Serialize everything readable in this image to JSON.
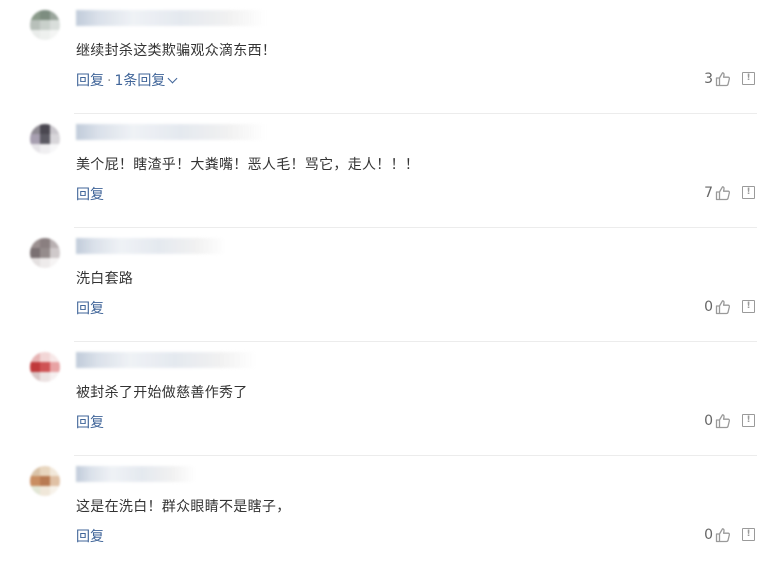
{
  "comments": [
    {
      "text": "继续封杀这类欺骗观众滴东西！",
      "reply_label": "回复",
      "reply_count_label": "1条回复",
      "likes": "3",
      "avatar_colors": [
        "#8a9a8a",
        "#7d8d80",
        "#9aa59c",
        "#b8c0ba",
        "#c9d0cb",
        "#d9dedb",
        "#e9ecea",
        "#eef0ee",
        "#f4f5f4"
      ]
    },
    {
      "text": "美个屁！瞎渣乎！大粪嘴！恶人毛！骂它，走人！！！",
      "reply_label": "回复",
      "likes": "7",
      "avatar_colors": [
        "#8e8a92",
        "#4a4750",
        "#c9c6cc",
        "#a79fb0",
        "#5c5a63",
        "#d8d6da",
        "#e6e4e8",
        "#f0eff1",
        "#f7f7f8"
      ]
    },
    {
      "text": "洗白套路",
      "reply_label": "回复",
      "likes": "0",
      "avatar_colors": [
        "#9a8f8f",
        "#8a7f80",
        "#b8b0b1",
        "#7a7072",
        "#958c8c",
        "#cfc9ca",
        "#e4e0e0",
        "#eeebeb",
        "#f6f4f4"
      ]
    },
    {
      "text": "被封杀了开始做慈善作秀了",
      "reply_label": "回复",
      "likes": "0",
      "avatar_colors": [
        "#e6b3b3",
        "#f2d6d6",
        "#f7e8e8",
        "#c0393b",
        "#cf5254",
        "#e8a3a4",
        "#d9c6c6",
        "#ece2e2",
        "#f6f0f0"
      ]
    },
    {
      "text": "这是在洗白！群众眼睛不是瞎子，",
      "reply_label": "回复",
      "likes": "0",
      "avatar_colors": [
        "#d9c3a8",
        "#e8d6bf",
        "#f2e8da",
        "#c98e62",
        "#b87a52",
        "#e0c1a5",
        "#e2e6d5",
        "#f0e7d9",
        "#f7f2ea"
      ]
    }
  ],
  "icons": {
    "like": "thumbs-up-icon",
    "report": "report-icon",
    "expand": "chevron-down-icon"
  },
  "colors": {
    "link": "#406599",
    "text": "#333333",
    "muted": "#666666",
    "divider": "#ececec"
  }
}
